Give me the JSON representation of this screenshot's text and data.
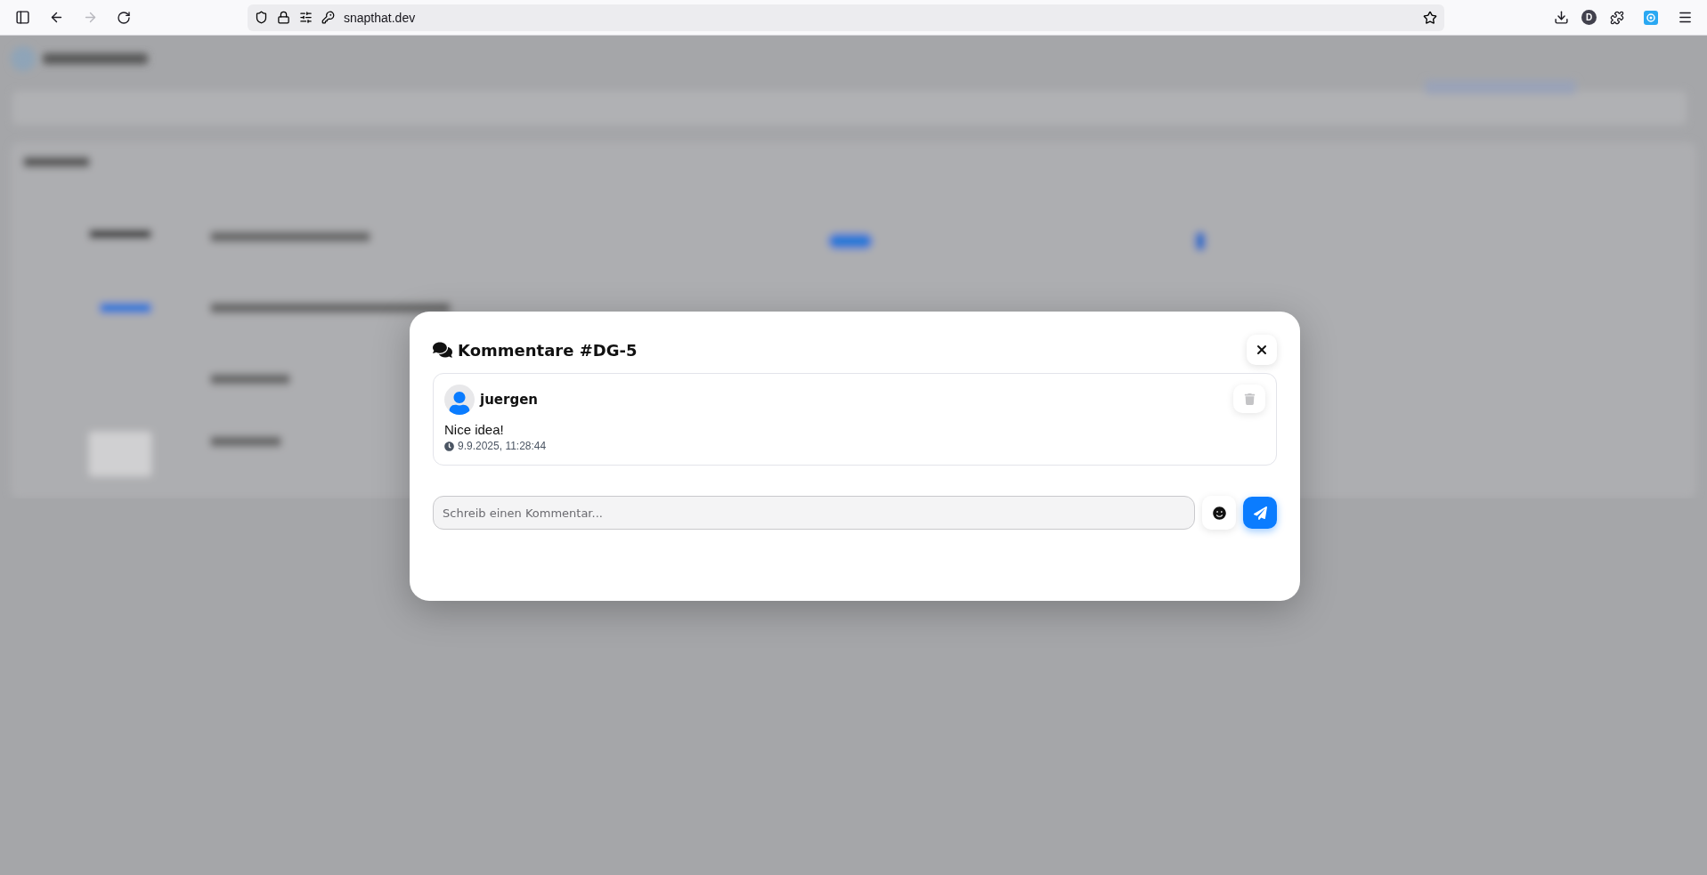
{
  "browser": {
    "url": "snapthat.dev",
    "back_disabled": false,
    "forward_disabled": true,
    "profile_initial": "D"
  },
  "dialog": {
    "title": "Kommentare #DG-5",
    "comments": [
      {
        "author": "juergen",
        "text": "Nice idea!",
        "time": "9.9.2025, 11:28:44"
      }
    ],
    "input": {
      "placeholder": "Schreib einen Kommentar..."
    }
  }
}
